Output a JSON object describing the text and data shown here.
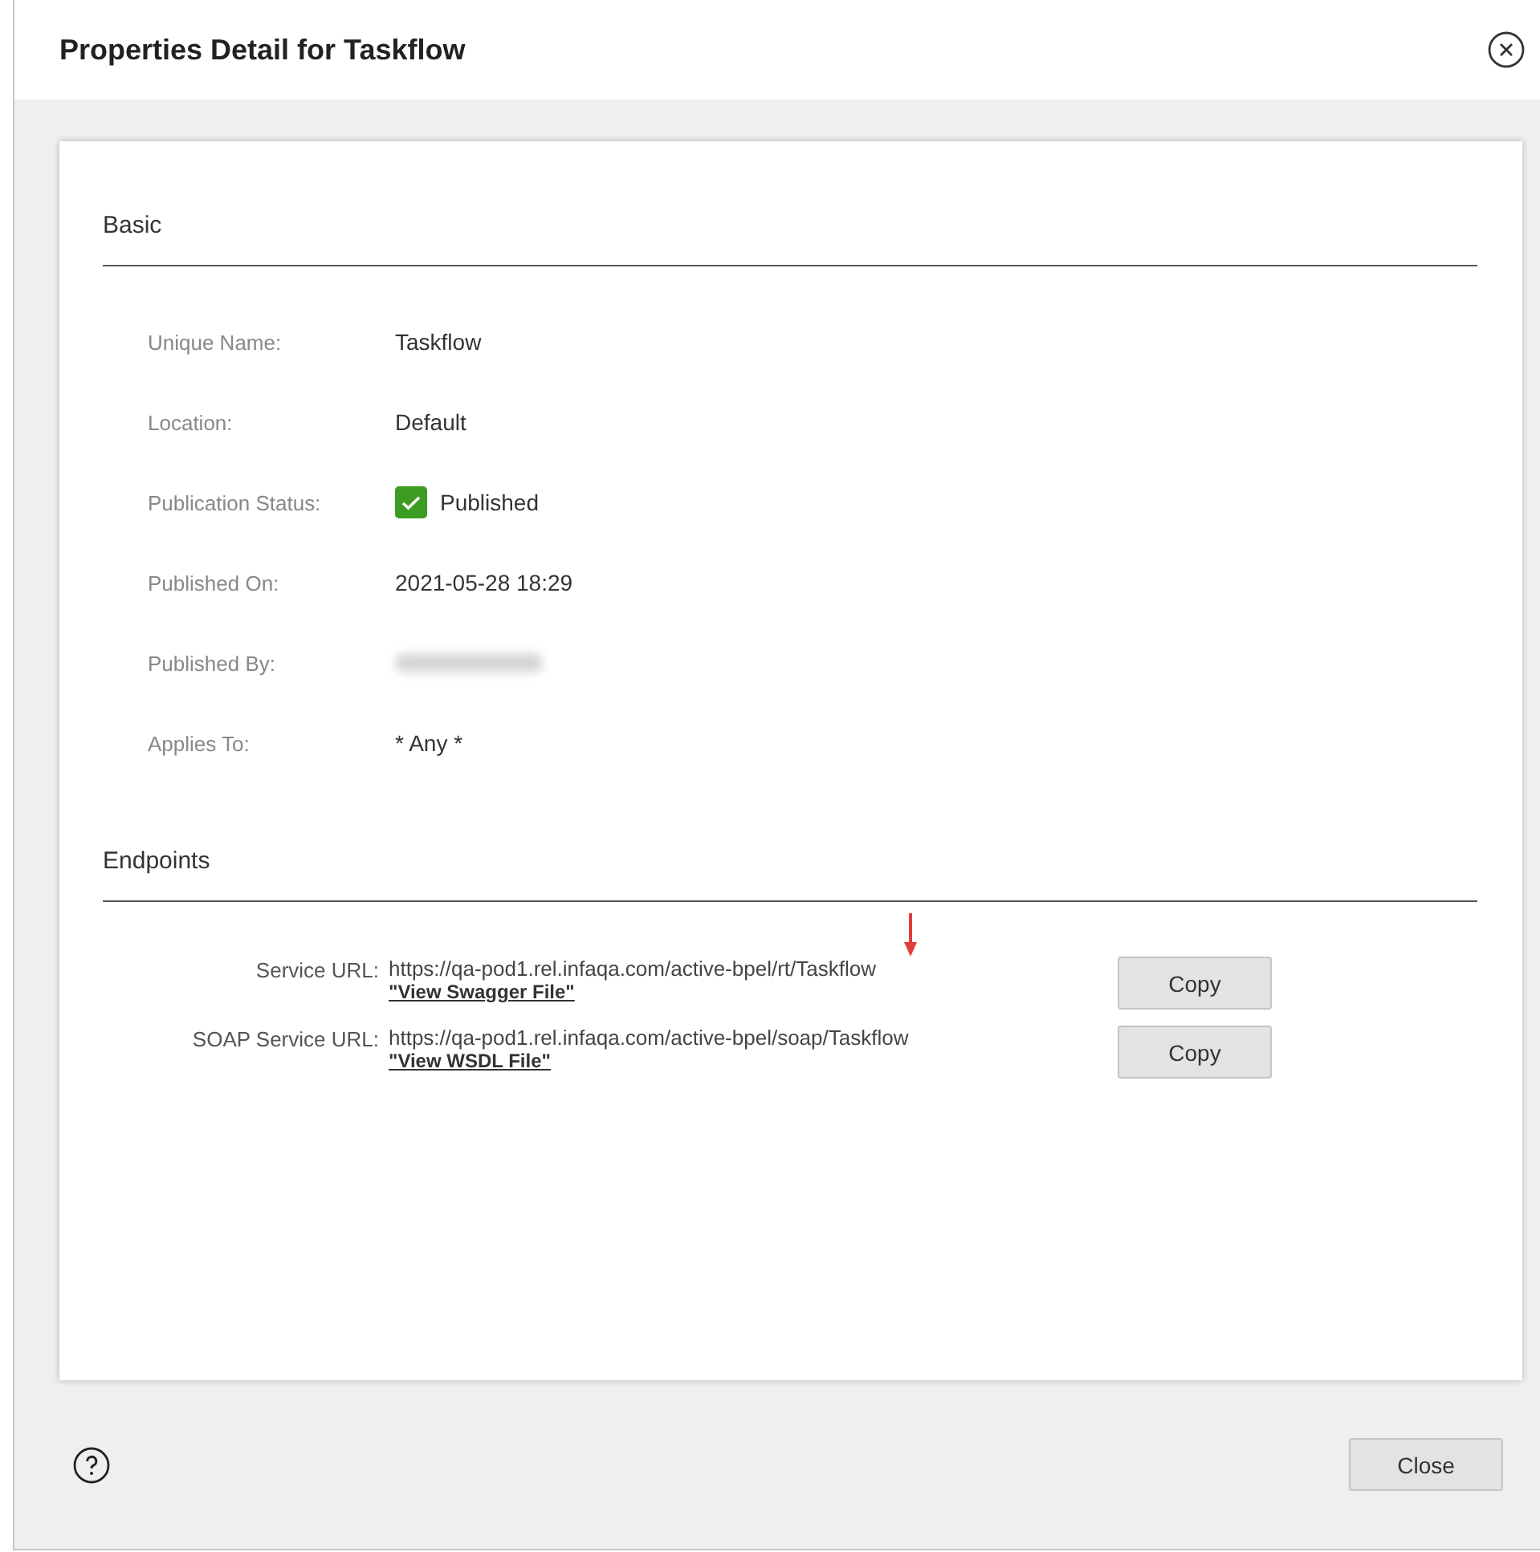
{
  "dialog": {
    "title": "Properties Detail for Taskflow"
  },
  "sections": [
    {
      "title": "Basic",
      "kind": "properties",
      "rows": [
        {
          "label": "Unique Name:",
          "kind": "text",
          "value": "Taskflow"
        },
        {
          "label": "Location:",
          "kind": "text",
          "value": "Default"
        },
        {
          "label": "Publication Status:",
          "kind": "status",
          "checked": true,
          "value": "Published"
        },
        {
          "label": "Published On:",
          "kind": "text",
          "value": "2021-05-28 18:29"
        },
        {
          "label": "Published By:",
          "kind": "blurred"
        },
        {
          "label": "Applies To:",
          "kind": "text",
          "value": "* Any *"
        }
      ]
    },
    {
      "title": "Endpoints",
      "kind": "endpoints",
      "rows": [
        {
          "label": "Service URL:",
          "url": "https://qa-pod1.rel.infaqa.com/active-bpel/rt/Taskflow",
          "link": "\"View Swagger File\"",
          "button": "Copy",
          "annotated": true
        },
        {
          "label": "SOAP Service URL:",
          "url": "https://qa-pod1.rel.infaqa.com/active-bpel/soap/Taskflow",
          "link": "\"View WSDL File\"",
          "button": "Copy",
          "annotated": false
        }
      ]
    }
  ],
  "footer": {
    "button": "Close"
  }
}
